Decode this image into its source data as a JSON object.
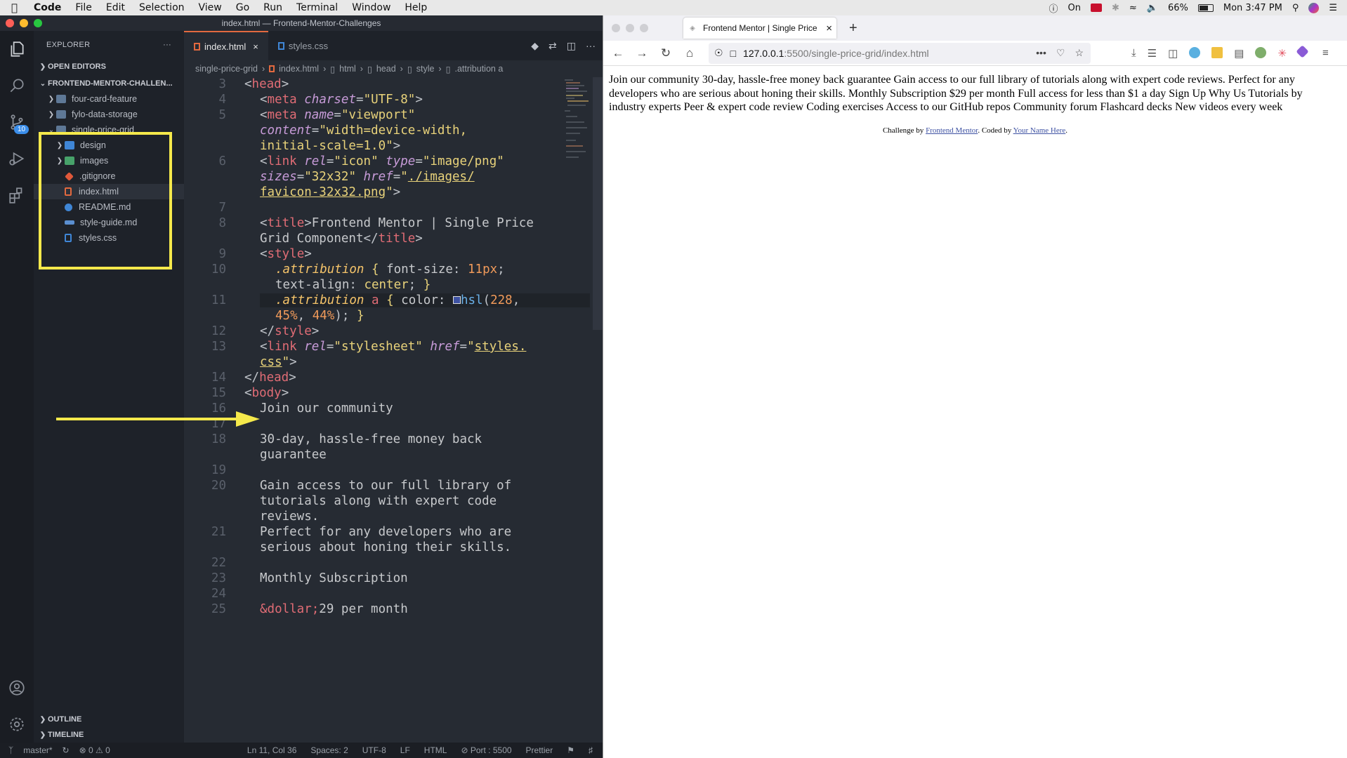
{
  "menubar": {
    "app": "Code",
    "items": [
      "File",
      "Edit",
      "Selection",
      "View",
      "Go",
      "Run",
      "Terminal",
      "Window",
      "Help"
    ],
    "clock": "Mon 3:47 PM",
    "battery": "66%",
    "focus": "On"
  },
  "vscode": {
    "window_title": "index.html — Frontend-Mentor-Challenges",
    "source_control_badge": "10",
    "explorer": {
      "title": "EXPLORER",
      "more": "···",
      "open_editors": "OPEN EDITORS",
      "workspace": "FRONTEND-MENTOR-CHALLEN...",
      "folders": [
        "four-card-feature",
        "fylo-data-storage",
        "single-price-grid"
      ],
      "children": [
        "design",
        "images",
        ".gitignore",
        "index.html",
        "README.md",
        "style-guide.md",
        "styles.css"
      ],
      "outline": "OUTLINE",
      "timeline": "TIMELINE"
    },
    "tabs": [
      {
        "label": "index.html",
        "close": "×"
      },
      {
        "label": "styles.css"
      }
    ],
    "breadcrumb": [
      "single-price-grid",
      "index.html",
      "html",
      "head",
      "style",
      ".attribution a"
    ],
    "line_numbers": [
      "3",
      "4",
      "5",
      "",
      "",
      "6",
      "",
      "",
      "7",
      "8",
      "",
      "9",
      "10",
      "",
      "11",
      "",
      "12",
      "13",
      "",
      "14",
      "15",
      "16",
      "17",
      "18",
      "",
      "19",
      "20",
      "",
      "",
      "21",
      "",
      "22",
      "23",
      "24",
      "25"
    ],
    "status": {
      "branch": "master*",
      "problems": "⊗ 0 ⚠ 0",
      "position": "Ln 11, Col 36",
      "spaces": "Spaces: 2",
      "encoding": "UTF-8",
      "eol": "LF",
      "language": "HTML",
      "port": "⊘ Port : 5500",
      "formatter": "Prettier"
    }
  },
  "firefox": {
    "tab_title": "Frontend Mentor | Single Price",
    "tab_close": "×",
    "new_tab": "+",
    "url_host": "127.0.0.1",
    "url_rest": ":5500/single-price-grid/index.html",
    "url_more": "•••",
    "body_text": "Join our community 30-day, hassle-free money back guarantee Gain access to our full library of tutorials along with expert code reviews. Perfect for any developers who are serious about honing their skills. Monthly Subscription $29 per month Full access for less than $1 a day Sign Up Why Us Tutorials by industry experts Peer & expert code review Coding exercises Access to our GitHub repos Community forum Flashcard decks New videos every week",
    "attribution_pre": "Challenge by ",
    "attribution_link1": "Frontend Mentor",
    "attribution_mid": ". Coded by ",
    "attribution_link2": "Your Name Here",
    "attribution_end": "."
  },
  "colors": {
    "highlight_box": "#f5e94b",
    "arrow": "#f5e94b",
    "accent_tab": "#e2693f"
  }
}
